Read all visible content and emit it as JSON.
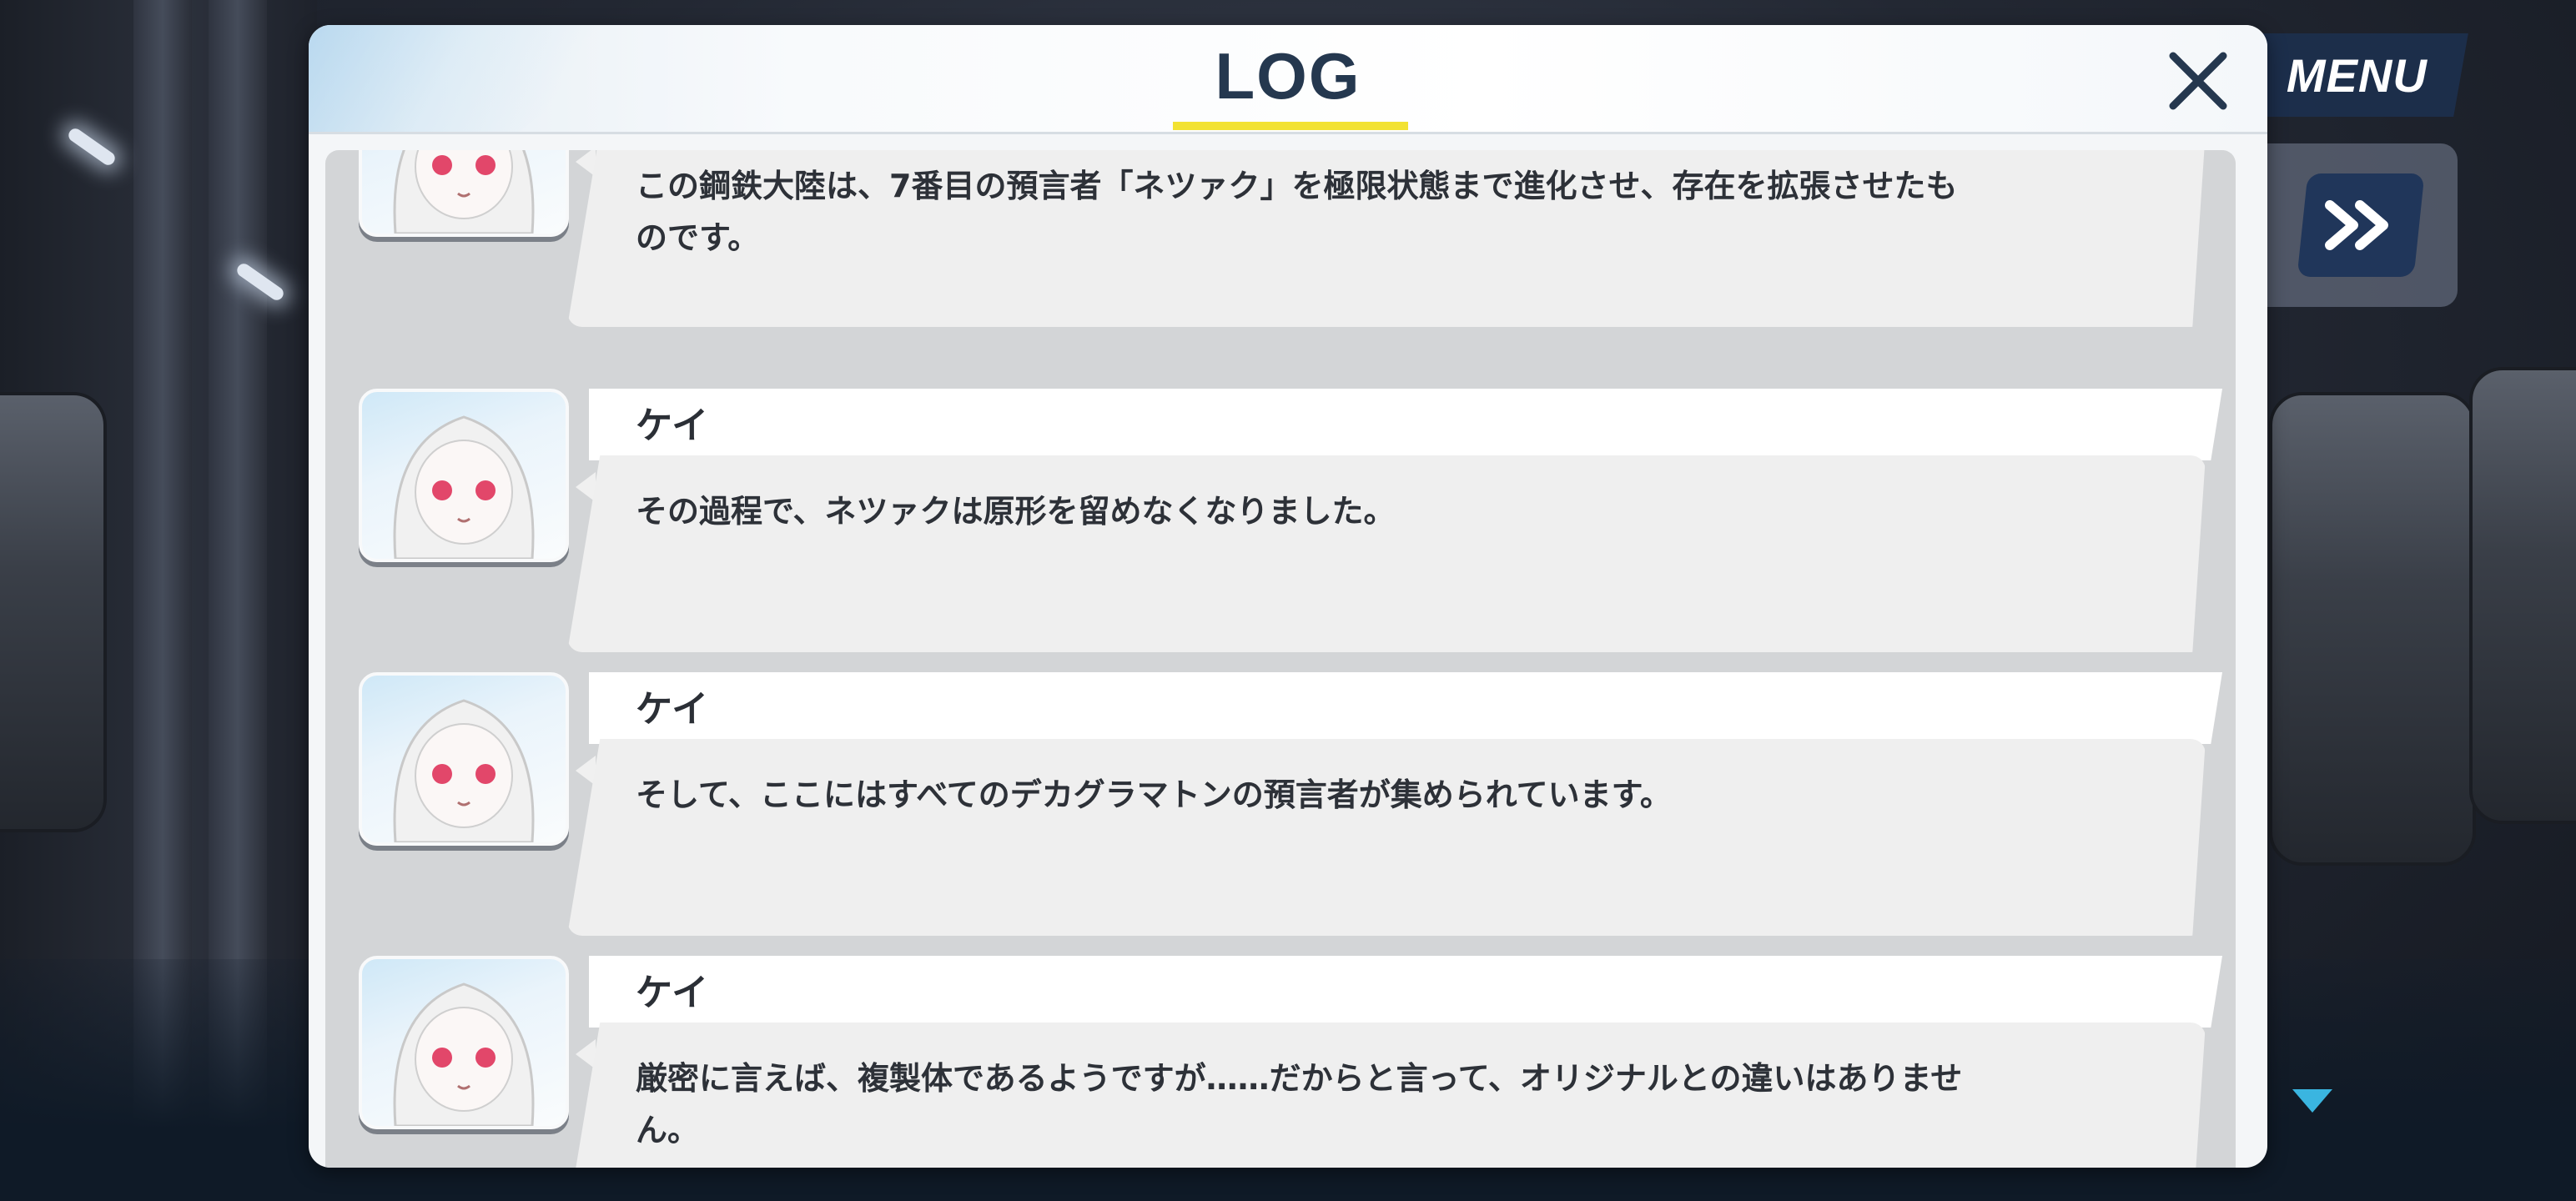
{
  "hud": {
    "menu_label": "MENU"
  },
  "log": {
    "title": "LOG",
    "entries": [
      {
        "speaker": "",
        "text": "この鋼鉄大陸は、7番目の預言者「ネツァク」を極限状態まで進化させ、存在を拡張させたものです。"
      },
      {
        "speaker": "ケイ",
        "text": "その過程で、ネツァクは原形を留めなくなりました。"
      },
      {
        "speaker": "ケイ",
        "text": "そして、ここにはすべてのデカグラマトンの預言者が集められています。"
      },
      {
        "speaker": "ケイ",
        "text": "厳密に言えば、複製体であるようですが……だからと言って、オリジナルとの違いはありません。"
      }
    ]
  },
  "icons": {
    "close": "close-icon",
    "fast_forward": "fast-forward-icon",
    "scroll_down": "chevron-down-icon"
  },
  "colors": {
    "title": "#25384f",
    "underline": "#f2e232",
    "menu_bg": "#1c3050",
    "accent_arrow": "#3ab5e0"
  }
}
